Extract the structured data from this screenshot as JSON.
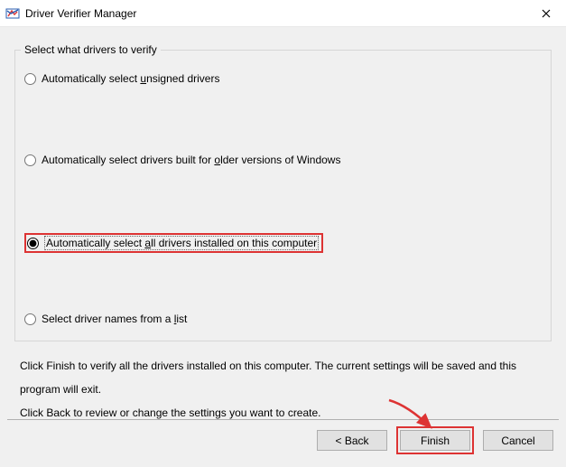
{
  "window": {
    "title": "Driver Verifier Manager"
  },
  "group": {
    "legend": "Select what drivers to verify",
    "options": {
      "unsigned": {
        "pre": "Automatically select ",
        "mn": "u",
        "post": "nsigned drivers"
      },
      "older": {
        "pre": "Automatically select drivers built for ",
        "mn": "o",
        "post": "lder versions of Windows"
      },
      "all": {
        "pre": "Automatically select ",
        "mn": "a",
        "post": "ll drivers installed on this computer"
      },
      "list": {
        "pre": "Select driver names from a ",
        "mn": "l",
        "post": "ist"
      }
    },
    "selected": "all"
  },
  "instructions": {
    "line1": "Click Finish to verify all the drivers installed on this computer. The current settings will be saved and this program will exit.",
    "line2": "Click Back to review or change the settings you want to create."
  },
  "buttons": {
    "back": "< Back",
    "finish": "Finish",
    "cancel": "Cancel"
  }
}
